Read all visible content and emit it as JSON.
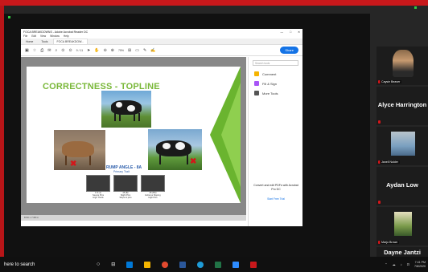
{
  "window": {
    "title": "FOCA BREAKDOWNS - Adobe Acrobat Reader DC",
    "menu": [
      "File",
      "Edit",
      "View",
      "Window",
      "Help"
    ],
    "controls": [
      "—",
      "□",
      "✕"
    ]
  },
  "tabs": [
    {
      "label": "Home"
    },
    {
      "label": "Tools"
    },
    {
      "label": "FOCA BREAKDOW..."
    }
  ],
  "toolbar": {
    "page": "9 / 11",
    "zoom": "75%",
    "share_label": "Share"
  },
  "slide": {
    "title": "CORRECTNESS - TOPLINE",
    "rump_label": "RUMP ANGLE - 8A",
    "rump_sub": "Primary Trait",
    "captions": [
      "1-5 (1)\nSevere Pins\nHigh Thurls",
      "25 (B)\nSlight Pins\nSlope to pins",
      "45 (5/6)\nExtreme Sloping\nHigh Pins"
    ]
  },
  "pagebar": {
    "text": "8.50 x 7.68 in"
  },
  "right_panel": {
    "search_placeholder": "Search tools",
    "tools": [
      {
        "label": "Comment",
        "color": "#f5b400"
      },
      {
        "label": "Fill & Sign",
        "color": "#a855f7"
      },
      {
        "label": "More Tools",
        "color": "#555555"
      }
    ],
    "promo": "Convert and edit PDFs with Acrobat Pro DC",
    "promo_link": "Start Free Trial"
  },
  "participants": [
    {
      "name": "Caysie Beaver",
      "type": "video"
    },
    {
      "name": "Alyce Harrington",
      "type": "name"
    },
    {
      "name": "Janell Nolder",
      "type": "video"
    },
    {
      "name": "Aydan Low",
      "type": "name"
    },
    {
      "name": "Marjo Brown",
      "type": "video"
    },
    {
      "name": "Dayne Jantzi",
      "type": "name"
    }
  ],
  "taskbar": {
    "search_text": "here to search",
    "time": "7:41 PM",
    "date": "7/8/2020"
  }
}
